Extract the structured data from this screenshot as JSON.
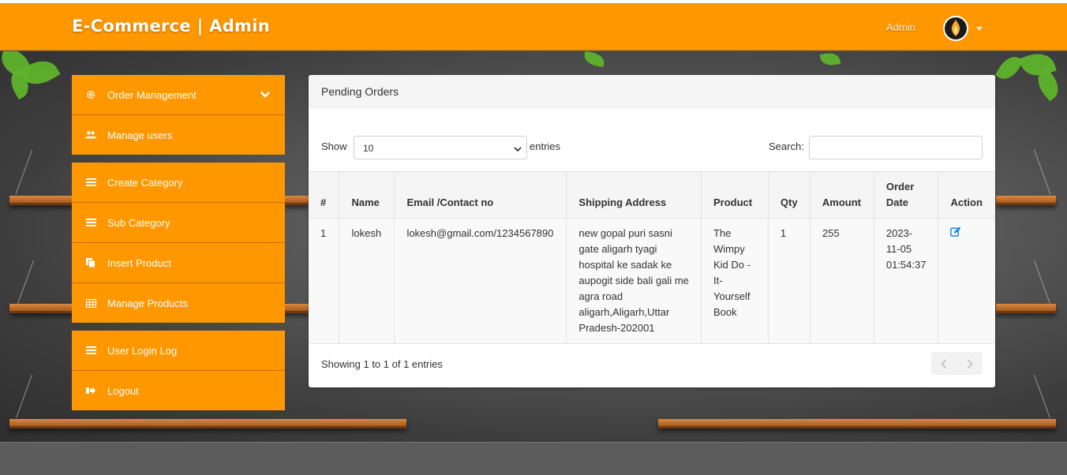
{
  "header": {
    "brand": "E-Commerce | Admin",
    "admin_label": "Admin"
  },
  "sidebar": {
    "groups": [
      [
        {
          "label": "Order Management",
          "icon": "gear-icon",
          "expanded": true
        },
        {
          "label": "Manage users",
          "icon": "users-icon"
        }
      ],
      [
        {
          "label": "Create Category",
          "icon": "list-icon"
        },
        {
          "label": "Sub Category",
          "icon": "list-icon"
        },
        {
          "label": "Insert Product",
          "icon": "copy-icon"
        },
        {
          "label": "Manage Products",
          "icon": "table-icon"
        }
      ],
      [
        {
          "label": "User Login Log",
          "icon": "list-icon"
        },
        {
          "label": "Logout",
          "icon": "sign-out-icon"
        }
      ]
    ]
  },
  "panel": {
    "title": "Pending Orders",
    "show_label": "Show",
    "entries_value": "10",
    "entries_label": "entries",
    "search_label": "Search:",
    "search_value": "",
    "columns": [
      "#",
      "Name",
      "Email /Contact no",
      "Shipping Address",
      "Product",
      "Qty",
      "Amount",
      "Order Date",
      "Action"
    ],
    "rows": [
      {
        "num": "1",
        "name": "lokesh",
        "email": "lokesh@gmail.com/1234567890",
        "address": "new gopal puri sasni gate aligarh tyagi hospital ke sadak ke aupogit side bali gali me agra road aligarh,Aligarh,Uttar Pradesh-202001",
        "product": "The Wimpy Kid Do -It-Yourself Book",
        "qty": "1",
        "amount": "255",
        "date": "2023-11-05 01:54:37",
        "action_icon": "edit-icon"
      }
    ],
    "info": "Showing 1 to 1 of 1 entries"
  },
  "colors": {
    "accent": "#ff9700",
    "link": "#1e88e5"
  }
}
